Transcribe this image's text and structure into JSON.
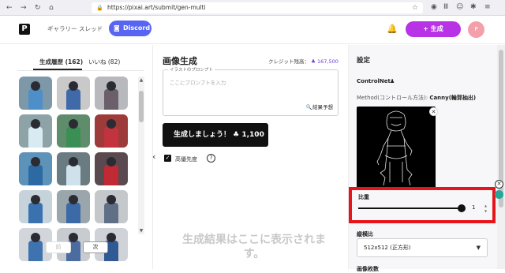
{
  "browser": {
    "url": "https://pixai.art/submit/gen-multi"
  },
  "nav": {
    "gallery": "ギャラリー",
    "thread": "スレッド",
    "discord": "Discord",
    "generate": "+ 生成",
    "avatar_initial": "P"
  },
  "left": {
    "tab_history": "生成履歴 (162)",
    "tab_likes": "いいね (82)",
    "thumbnails": [
      {
        "bg": "#7d98a8",
        "body": "#4f8fc9"
      },
      {
        "bg": "#c9c9c9",
        "body": "#3f69a8"
      },
      {
        "bg": "#b7b9bd",
        "body": "#6a5f6b"
      },
      {
        "bg": "#8ea3a7",
        "body": "#d9ebf2"
      },
      {
        "bg": "#5f8d6b",
        "body": "#3a8f55"
      },
      {
        "bg": "#9d3a3a",
        "body": "#c2333d"
      },
      {
        "bg": "#5d93b9",
        "body": "#2d6aa4"
      },
      {
        "bg": "#6a7b82",
        "body": "#cfe2ec"
      },
      {
        "bg": "#5a4a4f",
        "body": "#c02a34"
      },
      {
        "bg": "#c7d3db",
        "body": "#3a72b0"
      },
      {
        "bg": "#9aa5ac",
        "body": "#3b6aa6"
      },
      {
        "bg": "#c4c8cb",
        "body": "#5f6f86"
      },
      {
        "bg": "#d2d6da",
        "body": "#3f73b0"
      },
      {
        "bg": "#c8cbcf",
        "body": "#4a6ca0"
      },
      {
        "bg": "#cfd2d6",
        "body": "#2f5a93"
      }
    ],
    "prev": "前",
    "next": "次"
  },
  "middle": {
    "title": "画像生成",
    "credit_label": "クレジット残高：",
    "credit_value": "167,500",
    "prompt_label": "イラストのプロンプト",
    "prompt_placeholder": "ここにプロンプトを入力",
    "predict": "結果予想",
    "run_label": "生成しましょう！",
    "run_cost": "1,100",
    "priority_label": "高優先度",
    "result_placeholder": "生成結果はここに表示されます。"
  },
  "settings": {
    "title": "設定",
    "controlnet_title": "ControlNet",
    "method_label": "Method(コントロール方法):",
    "method_value": "Canny(輪郭抽出)",
    "weight_label": "比重",
    "weight_value": "1",
    "aspect_label": "縦横比",
    "aspect_value": "512x512 (正方形)",
    "next_label": "画像枚数"
  },
  "colors": {
    "accent": "#b832e6",
    "discord": "#5865f2",
    "highlight_box": "#e8141c"
  }
}
